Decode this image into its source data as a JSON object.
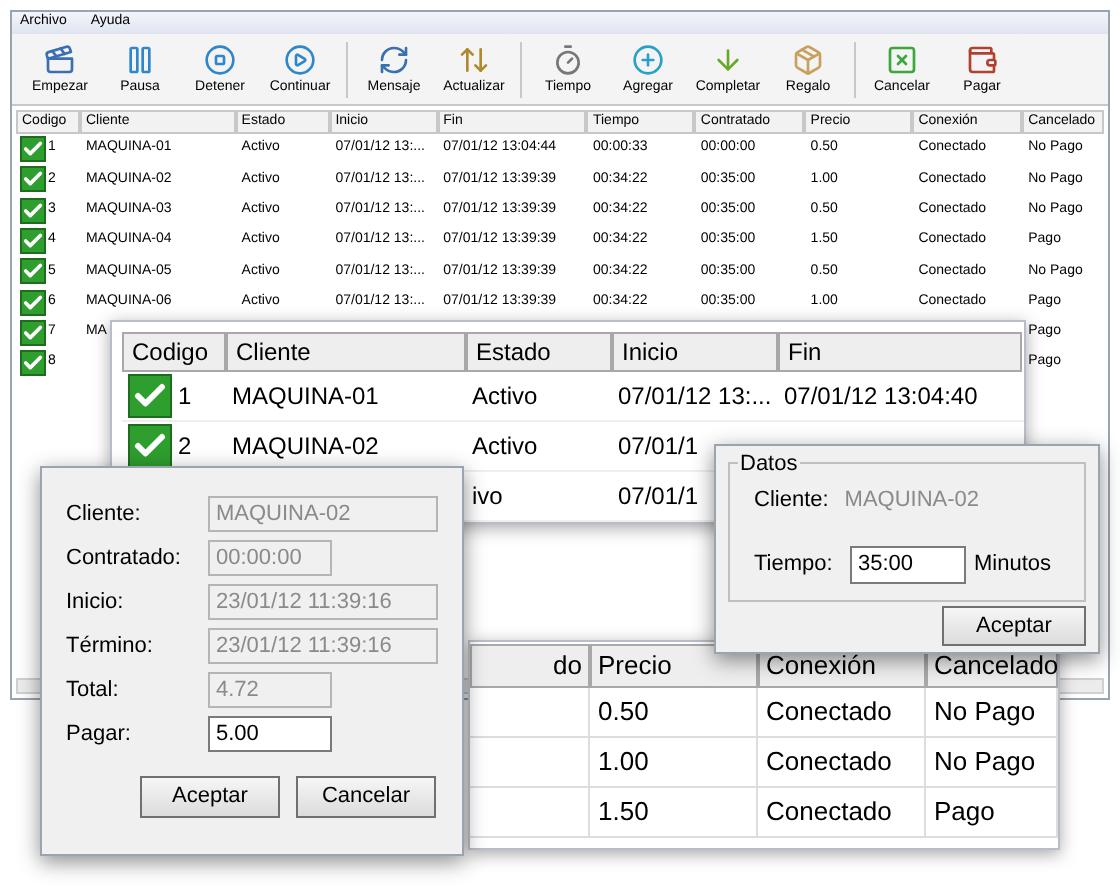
{
  "menu": [
    "Archivo",
    "Ayuda"
  ],
  "toolbar": [
    "Empezar",
    "Pausa",
    "Detener",
    "Continuar",
    "Mensaje",
    "Actualizar",
    "Tiempo",
    "Agregar",
    "Completar",
    "Regalo",
    "Cancelar",
    "Pagar"
  ],
  "main_table": {
    "columns": [
      "Codigo",
      "Cliente",
      "Estado",
      "Inicio",
      "Fin",
      "Tiempo",
      "Contratado",
      "Precio",
      "Conexión",
      "Cancelado"
    ],
    "rows": [
      [
        "1",
        "MAQUINA-01",
        "Activo",
        "07/01/12 13:...",
        "07/01/12 13:04:44",
        "00:00:33",
        "00:00:00",
        "0.50",
        "Conectado",
        "No Pago"
      ],
      [
        "2",
        "MAQUINA-02",
        "Activo",
        "07/01/12 13:...",
        "07/01/12 13:39:39",
        "00:34:22",
        "00:35:00",
        "1.00",
        "Conectado",
        "No Pago"
      ],
      [
        "3",
        "MAQUINA-03",
        "Activo",
        "07/01/12 13:...",
        "07/01/12 13:39:39",
        "00:34:22",
        "00:35:00",
        "0.50",
        "Conectado",
        "No Pago"
      ],
      [
        "4",
        "MAQUINA-04",
        "Activo",
        "07/01/12 13:...",
        "07/01/12 13:39:39",
        "00:34:22",
        "00:35:00",
        "1.50",
        "Conectado",
        "Pago"
      ],
      [
        "5",
        "MAQUINA-05",
        "Activo",
        "07/01/12 13:...",
        "07/01/12 13:39:39",
        "00:34:22",
        "00:35:00",
        "0.50",
        "Conectado",
        "No Pago"
      ],
      [
        "6",
        "MAQUINA-06",
        "Activo",
        "07/01/12 13:...",
        "07/01/12 13:39:39",
        "00:34:22",
        "00:35:00",
        "1.00",
        "Conectado",
        "Pago"
      ],
      [
        "7",
        "MA",
        null,
        null,
        null,
        null,
        null,
        null,
        null,
        "Pago"
      ],
      [
        "8",
        null,
        null,
        null,
        null,
        null,
        null,
        null,
        null,
        "Pago"
      ]
    ]
  },
  "zoom_table": {
    "columns": [
      "Codigo",
      "Cliente",
      "Estado",
      "Inicio",
      "Fin"
    ],
    "rows": [
      [
        "1",
        "MAQUINA-01",
        "Activo",
        "07/01/12 13:...",
        "07/01/12 13:04:40"
      ],
      [
        "2",
        "MAQUINA-02",
        "Activo",
        "07/01/1",
        null
      ],
      [
        null,
        null,
        "ivo",
        "07/01/1",
        null
      ]
    ]
  },
  "price_table": {
    "columns": [
      "do",
      "Precio",
      "Conexión",
      "Cancelado"
    ],
    "rows": [
      [
        null,
        "0.50",
        "Conectado",
        "No Pago"
      ],
      [
        null,
        "1.00",
        "Conectado",
        "No Pago"
      ],
      [
        null,
        "1.50",
        "Conectado",
        "Pago"
      ]
    ]
  },
  "pay_dialog": {
    "fields": [
      {
        "label": "Cliente:",
        "value": "MAQUINA-02",
        "disabled": true,
        "wide": true
      },
      {
        "label": "Contratado:",
        "value": "00:00:00",
        "disabled": true,
        "wide": false
      },
      {
        "label": "Inicio:",
        "value": "23/01/12 11:39:16",
        "disabled": true,
        "wide": true
      },
      {
        "label": "Término:",
        "value": "23/01/12 11:39:16",
        "disabled": true,
        "wide": true
      },
      {
        "label": "Total:",
        "value": "4.72",
        "disabled": true,
        "wide": false
      },
      {
        "label": "Pagar:",
        "value": "5.00",
        "disabled": false,
        "wide": false
      }
    ],
    "buttons": [
      "Aceptar",
      "Cancelar"
    ]
  },
  "time_dialog": {
    "group": "Datos",
    "client_label": "Cliente:",
    "client": "MAQUINA-02",
    "time_label": "Tiempo:",
    "time": "35:00",
    "unit": "Minutos",
    "button": "Aceptar"
  }
}
